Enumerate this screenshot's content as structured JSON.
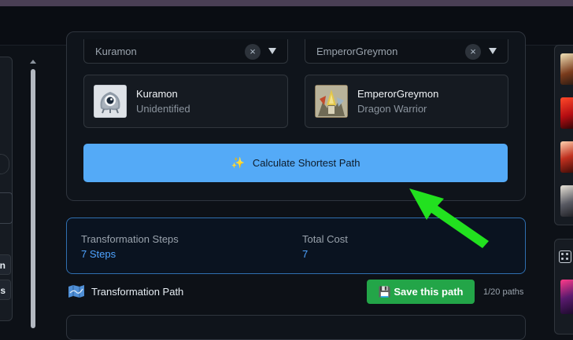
{
  "selectors": {
    "source": {
      "value": "Kuramon",
      "clear_glyph": "×"
    },
    "target": {
      "value": "EmperorGreymon",
      "clear_glyph": "×"
    }
  },
  "digimon_cards": [
    {
      "name": "Kuramon",
      "level": "Unidentified",
      "icon": "kuramon-portrait"
    },
    {
      "name": "EmperorGreymon",
      "level": "Dragon Warrior",
      "icon": "emperorgreymon-portrait"
    }
  ],
  "calculate": {
    "icon": "sparkles-icon",
    "glyph": "✨",
    "label": "Calculate Shortest Path"
  },
  "summary": {
    "steps_label": "Transformation Steps",
    "steps_value": "7 Steps",
    "cost_label": "Total Cost",
    "cost_value": "7"
  },
  "path_section": {
    "icon": "map-icon",
    "title": "Transformation Path",
    "save_glyph": "💾",
    "save_label": "Save this path",
    "count": "1/20 paths"
  },
  "left_sidebar": {
    "buttons": [
      "n",
      "ns"
    ]
  },
  "colors": {
    "background": "#0d1117",
    "primary_button": "#54aaf7",
    "save_button": "#23a548",
    "accent_value": "#4ea3ff",
    "annotation_arrow": "#22e11f"
  }
}
